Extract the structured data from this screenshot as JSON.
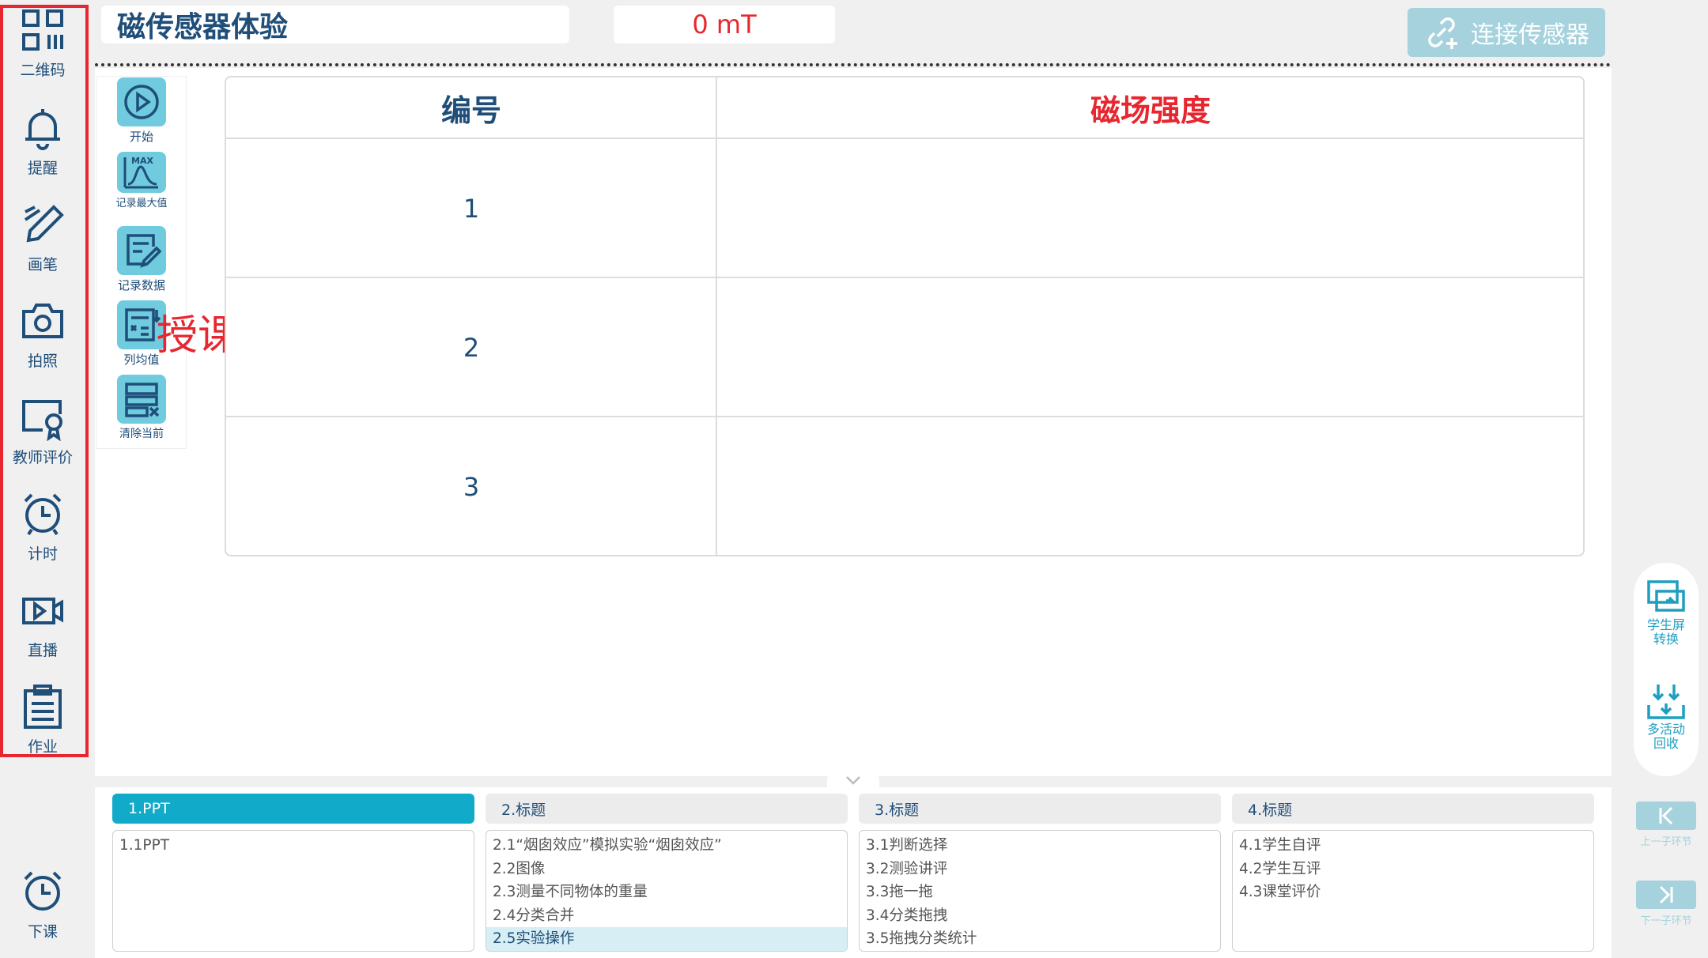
{
  "sidebar": {
    "items": [
      {
        "label": "二维码",
        "icon": "qr-code-icon"
      },
      {
        "label": "提醒",
        "icon": "bell-icon"
      },
      {
        "label": "画笔",
        "icon": "pen-icon"
      },
      {
        "label": "拍照",
        "icon": "camera-icon"
      },
      {
        "label": "教师评价",
        "icon": "teacher-evaluation-icon"
      },
      {
        "label": "计时",
        "icon": "alarm-clock-icon"
      },
      {
        "label": "直播",
        "icon": "live-video-icon"
      },
      {
        "label": "作业",
        "icon": "clipboard-icon"
      }
    ],
    "end_class": {
      "label": "下课",
      "icon": "clock-icon"
    }
  },
  "header": {
    "title": "磁传感器体验",
    "reading": "0 mT",
    "connect_label": "连接传感器"
  },
  "tools": {
    "items": [
      {
        "label": "开始",
        "icon": "play-icon"
      },
      {
        "label": "记录最大值",
        "icon": "max-record-icon"
      },
      {
        "label": "记录数据",
        "icon": "record-data-icon"
      },
      {
        "label": "列均值",
        "icon": "column-average-icon"
      },
      {
        "label": "清除当前",
        "icon": "clear-current-icon"
      }
    ],
    "annotation": "授课功能栏"
  },
  "table": {
    "headers": [
      "编号",
      "磁场强度"
    ],
    "rows": [
      {
        "no": "1",
        "value": ""
      },
      {
        "no": "2",
        "value": ""
      },
      {
        "no": "3",
        "value": ""
      }
    ]
  },
  "right_tools": {
    "switch_label_1": "学生屏",
    "switch_label_2": "转换",
    "collect_label_1": "多活动",
    "collect_label_2": "回收",
    "prev_label": "上一子环节",
    "next_label": "下一子环节"
  },
  "sections": [
    {
      "title": "1.PPT",
      "active": true,
      "items": [
        "1.1PPT"
      ]
    },
    {
      "title": "2.标题",
      "active": false,
      "items": [
        "2.1“烟囱效应”模拟实验“烟囱效应”",
        "2.2图像",
        "2.3测量不同物体的重量",
        "2.4分类合并",
        "2.5实验操作"
      ]
    },
    {
      "title": "3.标题",
      "active": false,
      "items": [
        "3.1判断选择",
        "3.2测验讲评",
        "3.3拖一拖",
        "3.4分类拖拽",
        "3.5拖拽分类统计"
      ]
    },
    {
      "title": "4.标题",
      "active": false,
      "items": [
        "4.1学生自评",
        "4.2学生互评",
        "4.3课堂评价"
      ]
    }
  ],
  "selected_item": "2.5实验操作",
  "colors": {
    "primary": "#1f4e79",
    "accent": "#12aac9",
    "highlight_red": "#e8262f",
    "button_disabled": "#a6d2dd"
  }
}
